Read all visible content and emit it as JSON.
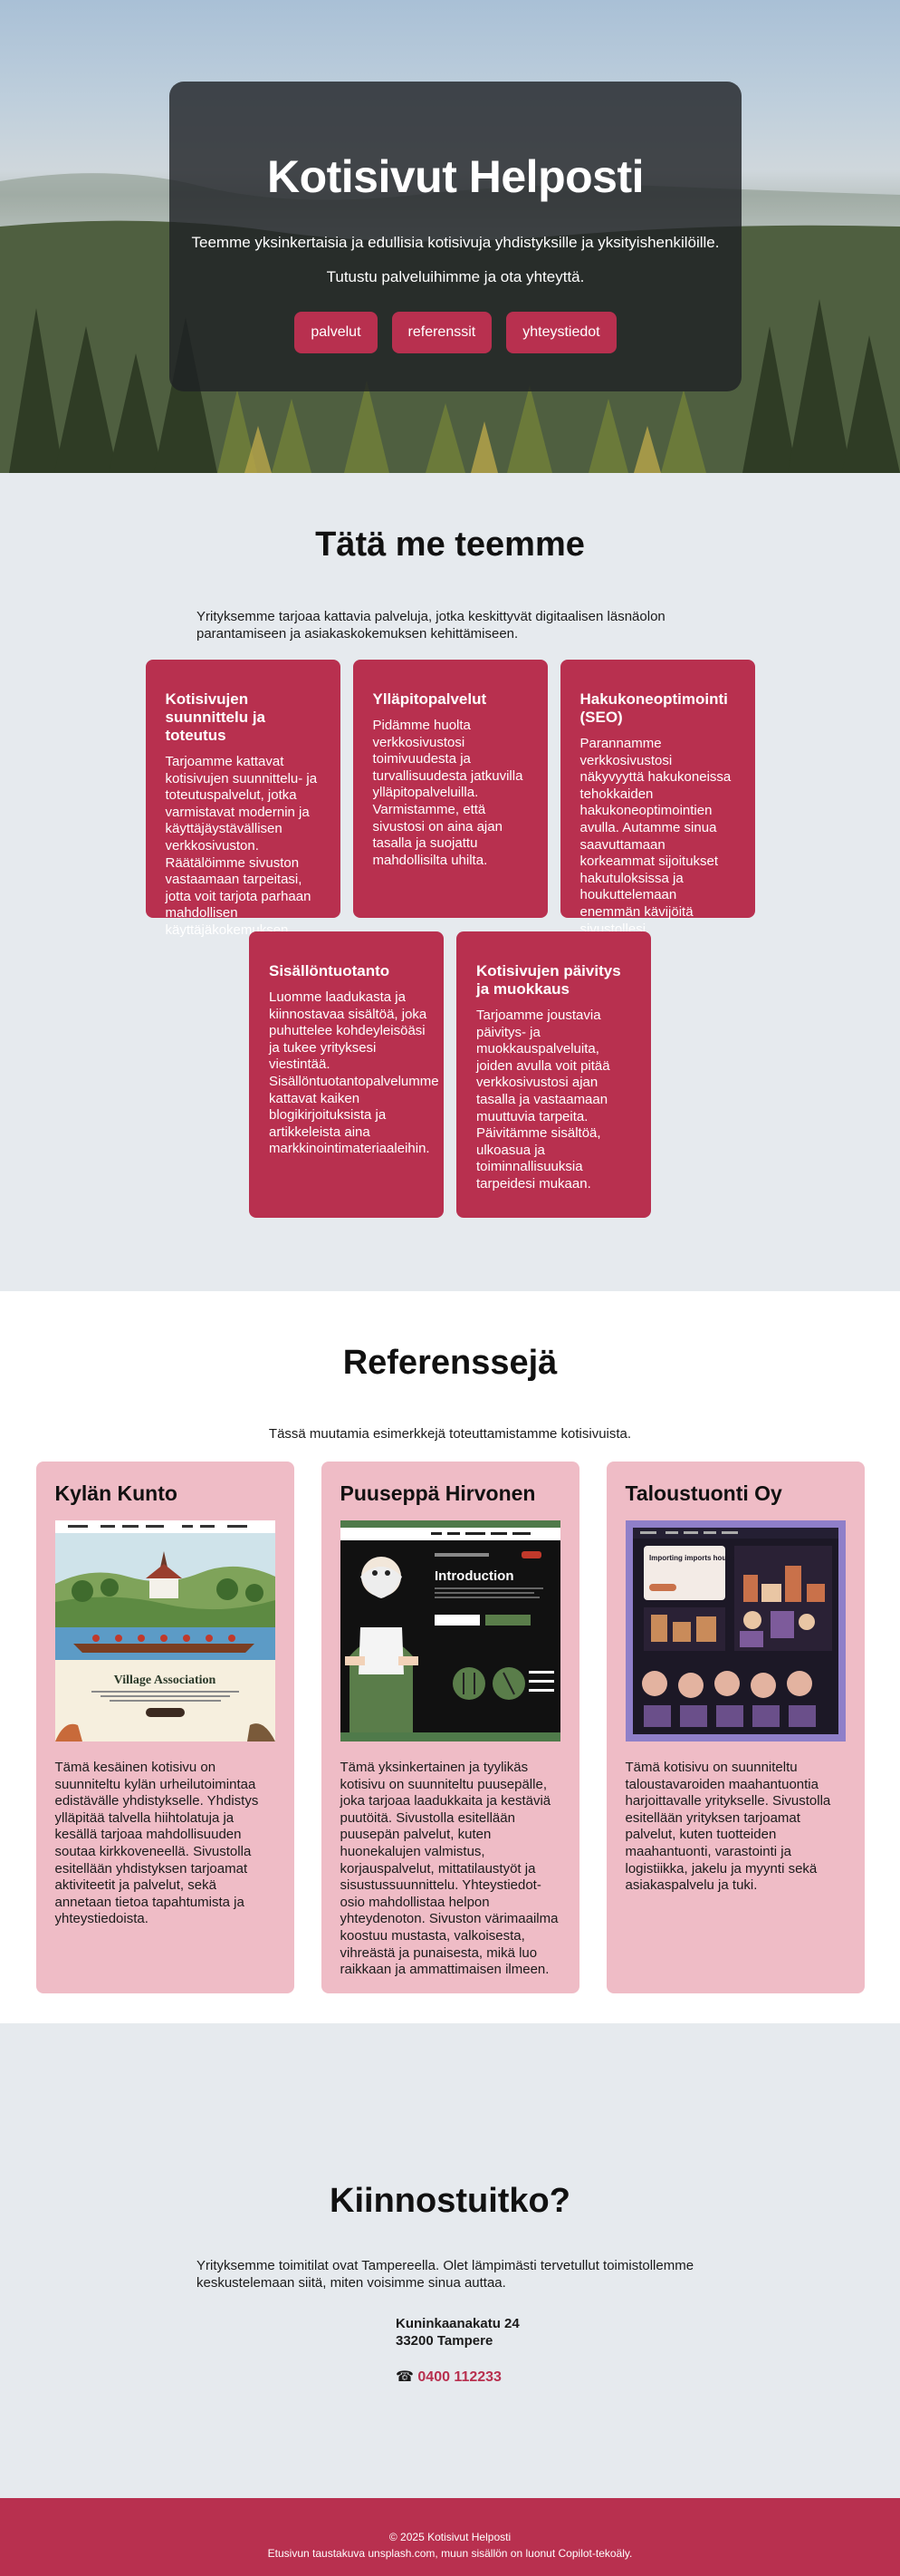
{
  "hero": {
    "title": "Kotisivut Helposti",
    "subtitle": "Teemme yksinkertaisia ja edullisia kotisivuja yhdistyksille ja yksityishenkilöille.",
    "tagline": "Tutustu palveluihimme ja ota yhteyttä.",
    "buttons": [
      "palvelut",
      "referenssit",
      "yhteystiedot"
    ]
  },
  "services": {
    "title": "Tätä me teemme",
    "intro": "Yrityksemme tarjoaa kattavia palveluja, jotka keskittyvät digitaalisen läsnäolon parantamiseen ja asiakaskokemuksen kehittämiseen.",
    "items": [
      {
        "title": "Kotisivujen suunnittelu ja toteutus",
        "text": "Tarjoamme kattavat kotisivujen suunnittelu- ja toteutuspalvelut, jotka varmistavat modernin ja käyttäjäystävällisen verkkosivuston. Räätälöimme sivuston vastaamaan tarpeitasi, jotta voit tarjota parhaan mahdollisen käyttäjäkokemuksen."
      },
      {
        "title": "Ylläpitopalvelut",
        "text": "Pidämme huolta verkkosivustosi toimivuudesta ja turvallisuudesta jatkuvilla ylläpitopalveluilla. Varmistamme, että sivustosi on aina ajan tasalla ja suojattu mahdollisilta uhilta."
      },
      {
        "title": "Hakukoneoptimointi (SEO)",
        "text": "Parannamme verkkosivustosi näkyvyyttä hakukoneissa tehokkaiden hakukoneoptimointien avulla. Autamme sinua saavuttamaan korkeammat sijoitukset hakutuloksissa ja houkuttelemaan enemmän kävijöitä sivustollesi."
      },
      {
        "title": "Sisällöntuotanto",
        "text": "Luomme laadukasta ja kiinnostavaa sisältöä, joka puhuttelee kohdeyleisöäsi ja tukee yrityksesi viestintää. Sisällöntuotantopalvelumme kattavat kaiken blogikirjoituksista ja artikkeleista aina markkinointimateriaaleihin."
      },
      {
        "title": "Kotisivujen päivitys ja muokkaus",
        "text": "Tarjoamme joustavia päivitys- ja muokkauspalveluita, joiden avulla voit pitää verkkosivustosi ajan tasalla ja vastaamaan muuttuvia tarpeita. Päivitämme sisältöä, ulkoasua ja toiminnallisuuksia tarpeidesi mukaan."
      }
    ]
  },
  "references": {
    "title": "Referenssejä",
    "intro": "Tässä muutamia esimerkkejä toteuttamistamme kotisivuista.",
    "items": [
      {
        "title": "Kylän Kunto",
        "shot_heading": "Village Association",
        "text": "Tämä kesäinen kotisivu on suunniteltu kylän urheilutoimintaa edistävälle yhdistykselle. Yhdistys ylläpitää talvella hiihtolatuja ja kesällä tarjoaa mahdollisuuden soutaa kirkkoveneellä. Sivustolla esitellään yhdistyksen tarjoamat aktiviteetit ja palvelut, sekä annetaan tietoa tapahtumista ja yhteystiedoista."
      },
      {
        "title": "Puuseppä Hirvonen",
        "shot_heading": "Introduction",
        "text": "Tämä yksinkertainen ja tyylikäs kotisivu on suunniteltu puusepälle, joka tarjoaa laadukkaita ja kestäviä puutöitä. Sivustolla esitellään puusepän palvelut, kuten huonekalujen valmistus, korjauspalvelut, mittatilaustyöt ja sisustussuunnittelu. Yhteystiedot-osio mahdollistaa helpon yhteydenoton. Sivuston värimaailma koostuu mustasta, valkoisesta, vihreästä ja punaisesta, mikä luo raikkaan ja ammattimaisen ilmeen."
      },
      {
        "title": "Taloustuonti Oy",
        "shot_heading": "Importing imports household goods",
        "text": "Tämä kotisivu on suunniteltu taloustavaroiden maahantuontia harjoittavalle yritykselle. Sivustolla esitellään yrityksen tarjoamat palvelut, kuten tuotteiden maahantuonti, varastointi ja logistiikka, jakelu ja myynti sekä asiakaspalvelu ja tuki."
      }
    ]
  },
  "contact": {
    "title": "Kiinnostuitko?",
    "intro": "Yrityksemme toimitilat ovat Tampereella. Olet lämpimästi tervetullut toimistollemme keskustelemaan siitä, miten voisimme sinua auttaa.",
    "street": "Kuninkaanakatu 24",
    "city": "33200 Tampere",
    "phone_icon": "☎",
    "phone": "0400 112233"
  },
  "footer": {
    "copyright": "© 2025 Kotisivut Helposti",
    "credits": "Etusivun taustakuva unsplash.com, muun sisällön on luonut Copilot-tekoäly."
  },
  "colors": {
    "accent": "#b8304f",
    "ref_card": "#efbcc6",
    "section_bg": "#e6eaee"
  }
}
